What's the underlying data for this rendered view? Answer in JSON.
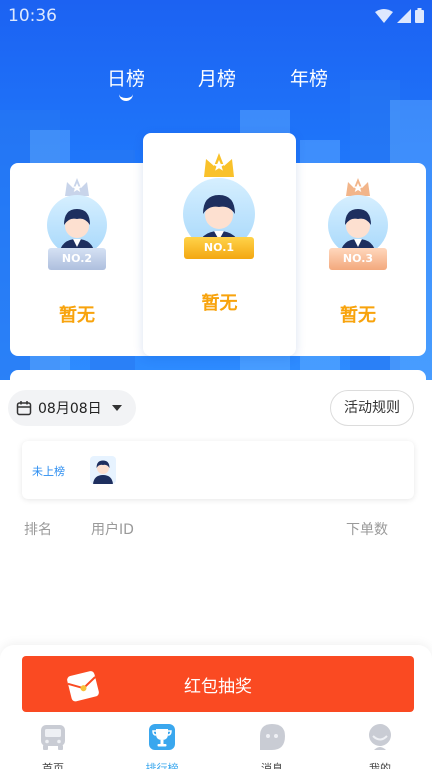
{
  "status_bar": {
    "time": "10:36"
  },
  "tabs": [
    {
      "label": "日榜",
      "active": true
    },
    {
      "label": "月榜",
      "active": false
    },
    {
      "label": "年榜",
      "active": false
    }
  ],
  "podium": {
    "first": {
      "badge": "NO.1",
      "name": "暂无"
    },
    "second": {
      "badge": "NO.2",
      "name": "暂无"
    },
    "third": {
      "badge": "NO.3",
      "name": "暂无"
    }
  },
  "filter": {
    "date": "08月08日",
    "rules_label": "活动规则"
  },
  "my_rank": {
    "status": "未上榜"
  },
  "table": {
    "columns": [
      "排名",
      "用户ID",
      "下单数"
    ]
  },
  "lottery": {
    "label": "红包抽奖"
  },
  "bottom_nav": [
    {
      "label": "首页",
      "icon": "bus-icon",
      "active": false
    },
    {
      "label": "排行榜",
      "icon": "trophy-icon",
      "active": true
    },
    {
      "label": "消息",
      "icon": "message-icon",
      "active": false
    },
    {
      "label": "我的",
      "icon": "profile-icon",
      "active": false
    }
  ],
  "colors": {
    "hero_blue": "#1f78fb",
    "gold": "#f8a30c",
    "lottery_red": "#fa4a22",
    "active_nav": "#3aa7ee"
  }
}
